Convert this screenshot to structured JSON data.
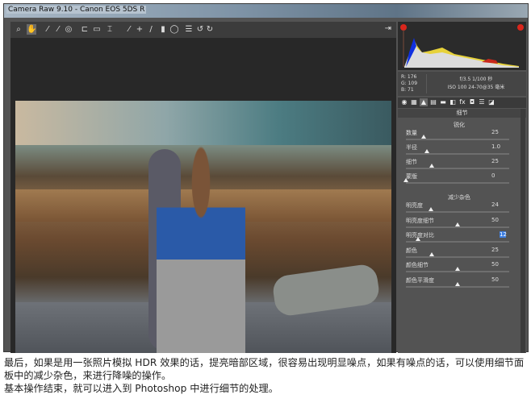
{
  "window": {
    "title": "Camera Raw 9.10 - Canon EOS 5DS R"
  },
  "toolbar": {
    "tools": [
      "zoom-icon",
      "hand-icon",
      "white-balance-icon",
      "color-sampler-icon",
      "target-adjust-icon",
      "crop-icon",
      "straighten-icon",
      "transform-icon",
      "spot-removal-icon",
      "red-eye-icon",
      "adjustment-brush-icon",
      "graduated-filter-icon",
      "radial-filter-icon",
      "presets-list-icon",
      "rotate-left-icon",
      "rotate-right-icon"
    ],
    "glyphs": [
      "⌕",
      "✋",
      "⁄",
      "⁄",
      "◎",
      "⊏",
      "▭",
      "⌶",
      "⁄",
      "+",
      "/",
      "▮",
      "◯",
      "☰",
      "↺",
      "↻"
    ]
  },
  "info": {
    "r": "R: 176",
    "g": "G: 109",
    "b": "B:  71",
    "exposure": "f/3.5  1/100 秒",
    "iso_lens": "ISO 100  24-70@35 毫米"
  },
  "tabs": [
    "◉",
    "▦",
    "▲",
    "▤",
    "▬",
    "◧",
    "fx",
    "◘",
    "☰",
    "◪"
  ],
  "panel": {
    "title": "细节",
    "sharpening": {
      "title": "锐化",
      "rows": [
        {
          "label": "数量",
          "value": "25",
          "pos": 0.17
        },
        {
          "label": "半径",
          "value": "1.0",
          "pos": 0.2
        },
        {
          "label": "细节",
          "value": "25",
          "pos": 0.25
        },
        {
          "label": "蒙版",
          "value": "0",
          "pos": 0
        }
      ]
    },
    "noise": {
      "title": "减少杂色",
      "rows": [
        {
          "label": "明亮度",
          "value": "24",
          "pos": 0.24
        },
        {
          "label": "明亮度细节",
          "value": "50",
          "pos": 0.5
        },
        {
          "label": "明亮度对比",
          "value": "12",
          "pos": 0.12
        },
        {
          "label": "颜色",
          "value": "25",
          "pos": 0.25
        },
        {
          "label": "颜色细节",
          "value": "50",
          "pos": 0.5
        },
        {
          "label": "颜色平滑度",
          "value": "50",
          "pos": 0.5
        }
      ]
    }
  },
  "caption": {
    "line1": "最后，如果是用一张照片模拟 HDR 效果的话，提亮暗部区域，很容易出现明显噪点，如果有噪点的话，可以使用细节面板中的减少杂色，来进行降噪的操作。",
    "line2": "基本操作结束，就可以进入到 Photoshop 中进行细节的处理。"
  },
  "colors": {
    "clip": "#d9261c",
    "selection": "#3d7ee0"
  }
}
